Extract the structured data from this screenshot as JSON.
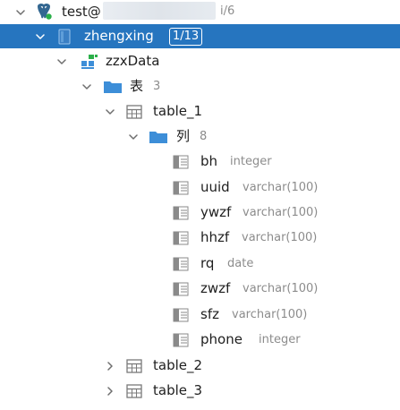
{
  "tree": {
    "connection": {
      "label": "test@",
      "suffix": "i/6"
    },
    "database": {
      "label": "zhengxing",
      "badge": "1/13"
    },
    "schema": {
      "label": "zzxData"
    },
    "tables_folder": {
      "label": "表",
      "count": "3"
    },
    "table_1": {
      "label": "table_1"
    },
    "columns_folder": {
      "label": "列",
      "count": "8"
    },
    "columns": [
      {
        "name": "bh",
        "type": "integer"
      },
      {
        "name": "uuid",
        "type": "varchar(100)"
      },
      {
        "name": "ywzf",
        "type": "varchar(100)"
      },
      {
        "name": "hhzf",
        "type": "varchar(100)"
      },
      {
        "name": "rq",
        "type": "date"
      },
      {
        "name": "zwzf",
        "type": "varchar(100)"
      },
      {
        "name": "sfz",
        "type": "varchar(100)"
      },
      {
        "name": "phone",
        "type": "integer"
      }
    ],
    "table_2": {
      "label": "table_2"
    },
    "table_3": {
      "label": "table_3"
    }
  },
  "colors": {
    "selection": "#2675bf",
    "folder": "#3d8ed8",
    "muted": "#8c8c8c",
    "icon_gray": "#8a8a8a"
  },
  "icons": {
    "connection": "postgresql-elephant-icon",
    "database": "database-icon",
    "schema": "schema-icon",
    "folder": "folder-icon",
    "table": "table-grid-icon",
    "column": "column-icon"
  }
}
